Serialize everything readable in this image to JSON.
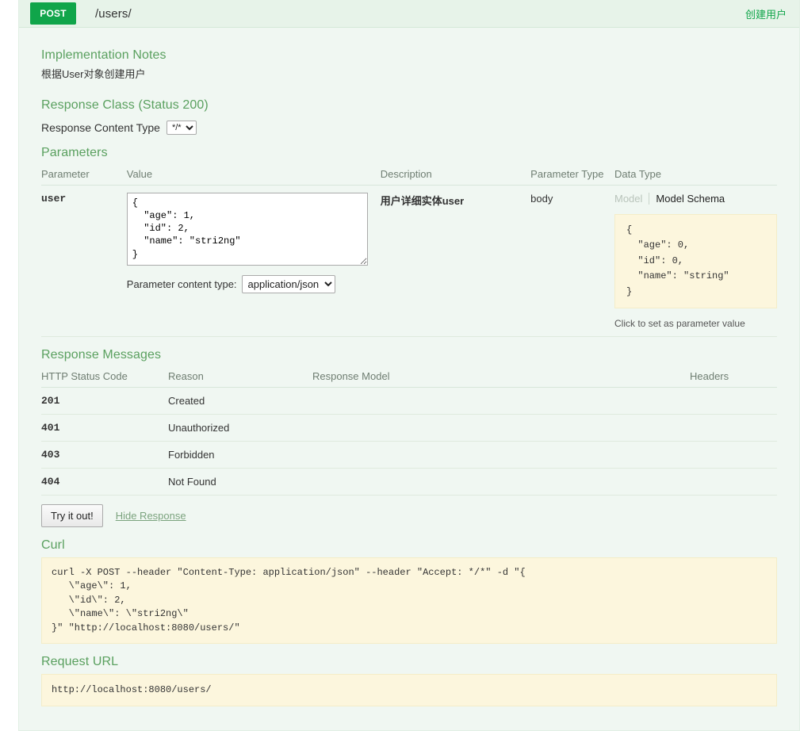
{
  "operation": {
    "method": "POST",
    "path": "/users/",
    "summary": "创建用户"
  },
  "implementation_notes": {
    "title": "Implementation Notes",
    "text": "根据User对象创建用户"
  },
  "response_class": {
    "title": "Response Class (Status 200)",
    "content_type_label": "Response Content Type",
    "content_type_value": "*/*",
    "content_type_options": [
      "*/*"
    ]
  },
  "parameters": {
    "title": "Parameters",
    "columns": [
      "Parameter",
      "Value",
      "Description",
      "Parameter Type",
      "Data Type"
    ],
    "rows": [
      {
        "name": "user",
        "value": "{\n  \"age\": 1,\n  \"id\": 2,\n  \"name\": \"stri2ng\"\n}",
        "content_type_label": "Parameter content type:",
        "content_type_value": "application/json",
        "content_type_options": [
          "application/json"
        ],
        "description": "用户详细实体user",
        "parameter_type": "body",
        "data_type": {
          "tab_model": "Model",
          "tab_model_schema": "Model Schema",
          "schema": "{\n  \"age\": 0,\n  \"id\": 0,\n  \"name\": \"string\"\n}",
          "hint": "Click to set as parameter value"
        }
      }
    ]
  },
  "response_messages": {
    "title": "Response Messages",
    "columns": [
      "HTTP Status Code",
      "Reason",
      "Response Model",
      "Headers"
    ],
    "rows": [
      {
        "code": "201",
        "reason": "Created",
        "model": "",
        "headers": ""
      },
      {
        "code": "401",
        "reason": "Unauthorized",
        "model": "",
        "headers": ""
      },
      {
        "code": "403",
        "reason": "Forbidden",
        "model": "",
        "headers": ""
      },
      {
        "code": "404",
        "reason": "Not Found",
        "model": "",
        "headers": ""
      }
    ]
  },
  "actions": {
    "submit_label": "Try it out!",
    "hide_response_label": "Hide Response"
  },
  "curl": {
    "title": "Curl",
    "command": "curl -X POST --header \"Content-Type: application/json\" --header \"Accept: */*\" -d \"{\n   \\\"age\\\": 1,\n   \\\"id\\\": 2,\n   \\\"name\\\": \\\"stri2ng\\\"\n}\" \"http://localhost:8080/users/\""
  },
  "request_url": {
    "title": "Request URL",
    "url": "http://localhost:8080/users/"
  },
  "colors": {
    "method_post": "#10a54a",
    "heading_bar": "#e7f3e9",
    "body_bg": "#f0f7f2",
    "section_title": "#5aa05f",
    "snippet_bg": "#fcf6dd"
  }
}
